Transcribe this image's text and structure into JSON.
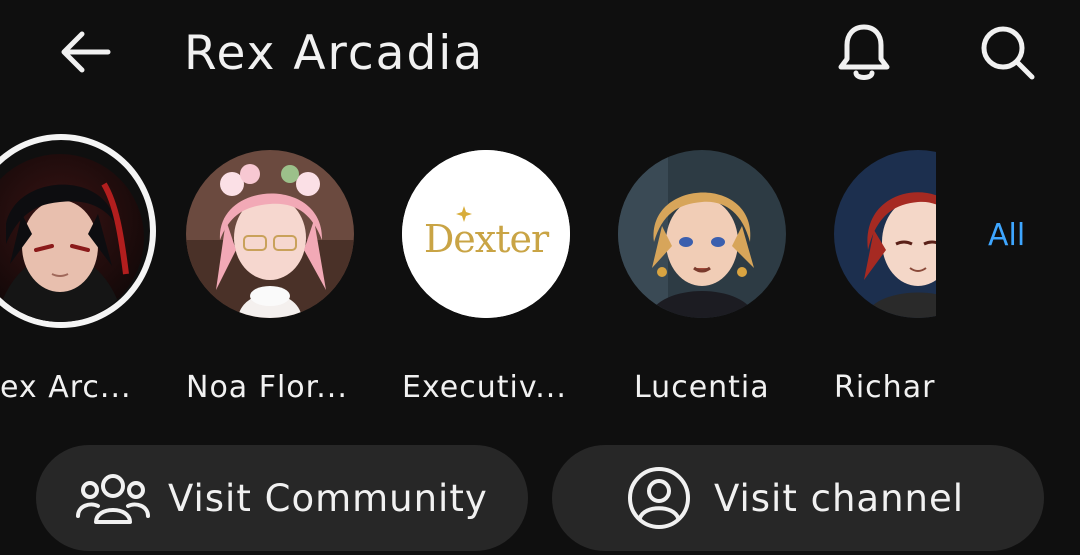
{
  "header": {
    "title": "Rex Arcadia",
    "back_icon": "arrow-left-icon",
    "notifications_icon": "bell-icon",
    "search_icon": "search-icon"
  },
  "channels": [
    {
      "name": "ex Arc...",
      "selected": true
    },
    {
      "name": "Noa Flor..."
    },
    {
      "name": "Executiv...",
      "logo_text": "Dexter"
    },
    {
      "name": "Lucentia"
    },
    {
      "name": "Richar"
    }
  ],
  "all_link": "All",
  "actions": {
    "community_label": "Visit Community",
    "channel_label": "Visit channel"
  },
  "colors": {
    "background": "#0f0f0f",
    "pill": "#272727",
    "accent_link": "#3ea6ff"
  }
}
